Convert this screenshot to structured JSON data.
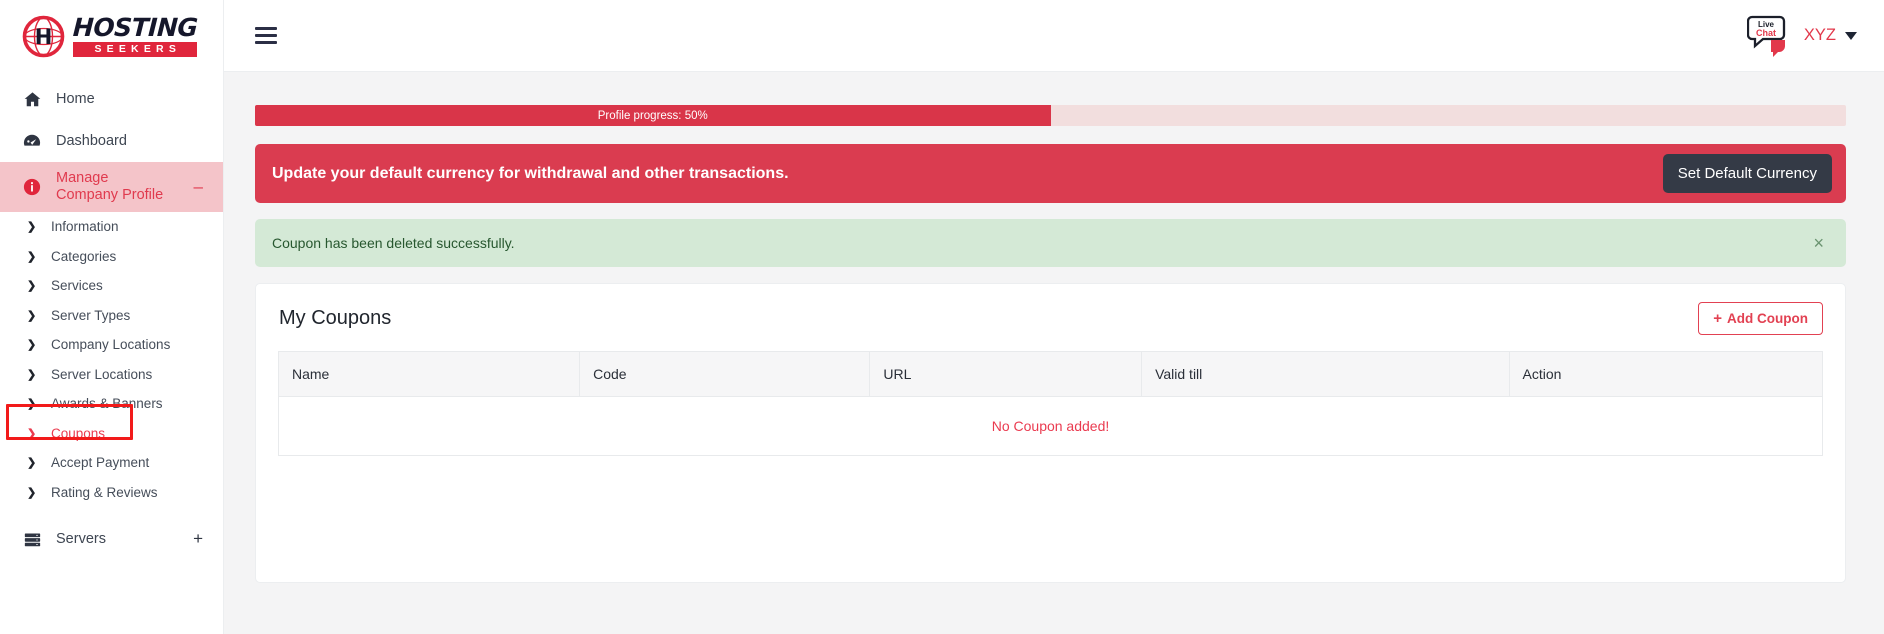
{
  "brand": {
    "logo_primary": "HOSTING",
    "logo_secondary": "SEEKERS",
    "globe_icon": "globe-icon"
  },
  "sidebar": {
    "items": [
      {
        "label": "Home",
        "icon": "home-icon"
      },
      {
        "label": "Dashboard",
        "icon": "dashboard-icon"
      }
    ],
    "active_group": {
      "label": "Manage Company Profile",
      "icon": "info-circle-icon",
      "collapse_sign": "–"
    },
    "sub_items": [
      {
        "label": "Information"
      },
      {
        "label": "Categories"
      },
      {
        "label": "Services"
      },
      {
        "label": "Server Types"
      },
      {
        "label": "Company Locations"
      },
      {
        "label": "Server Locations"
      },
      {
        "label": "Awards & Banners"
      },
      {
        "label": "Coupons"
      },
      {
        "label": "Accept Payment"
      },
      {
        "label": "Rating & Reviews"
      }
    ],
    "servers": {
      "label": "Servers",
      "icon": "server-rack-icon",
      "expand_sign": "+"
    }
  },
  "topbar": {
    "menu_toggle": "hamburger-icon",
    "live_chat": {
      "line1": "Live",
      "line2": "Chat"
    },
    "user": "XYZ"
  },
  "progress": {
    "label": "Profile progress: 50%",
    "percent": 50
  },
  "currency_alert": {
    "message": "Update your default currency for withdrawal and other transactions.",
    "button": "Set Default Currency"
  },
  "success_alert": {
    "message": "Coupon has been deleted successfully.",
    "close": "×"
  },
  "coupons_card": {
    "title": "My Coupons",
    "add_button": "Add Coupon",
    "add_button_plus": "+",
    "columns": [
      "Name",
      "Code",
      "URL",
      "Valid till",
      "Action"
    ],
    "empty_message": "No Coupon added!"
  },
  "colors": {
    "brand_red": "#e0263c",
    "alert_red": "#da3c50",
    "progress_fill": "#d93549",
    "progress_track": "#f2dede",
    "success_bg": "#d4e9d6",
    "dark_button": "#343a46",
    "highlight_outline": "#f21a1a"
  }
}
